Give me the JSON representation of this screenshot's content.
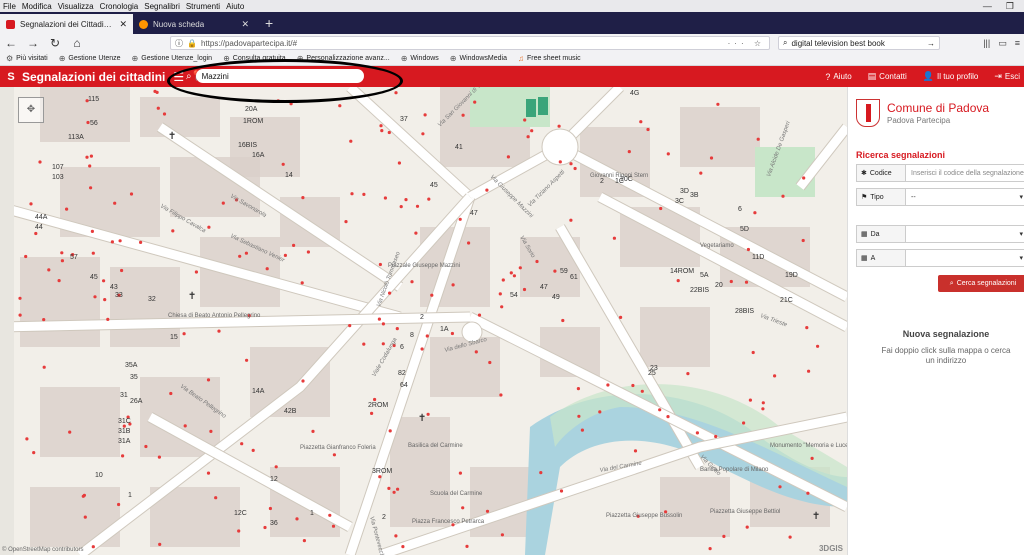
{
  "menubar": {
    "items": [
      "File",
      "Modifica",
      "Visualizza",
      "Cronologia",
      "Segnalibri",
      "Strumenti",
      "Aiuto"
    ]
  },
  "tabs": [
    {
      "label": "Segnalazioni dei Cittadini - Co",
      "active": true,
      "color": "#d71920"
    },
    {
      "label": "Nuova scheda",
      "active": false,
      "color": "#ff9500"
    }
  ],
  "address": {
    "url": "https://padovapartecipa.it/#",
    "search_value": "digital television best book"
  },
  "bookmarks": [
    "Più visitati",
    "Gestione Utenze",
    "Gestione Utenze_login",
    "Consulta gratuita",
    "Personalizzazione avanz...",
    "Windows",
    "WindowsMedia",
    "Free sheet music"
  ],
  "app": {
    "logo": "S",
    "title": "Segnalazioni dei cittadini",
    "search_value": "Mazzini",
    "nav": [
      "Aiuto",
      "Contatti",
      "Il tuo profilo",
      "Esci"
    ],
    "accent": "#d71920"
  },
  "map": {
    "place_labels": [
      "Piazzale Giuseppe Mazzini",
      "Piazzetta Gianfranco Foleria",
      "Piazza Francesco Petrarca",
      "Piazzetta Giuseppe Bussolin",
      "Piazzetta Giuseppe Bettiol",
      "Basilica del Carmine",
      "Chiesa di Beato Antonio Pellegrino",
      "Monumento \"Memoria e Luce\"",
      "Banca Popolare di Milano",
      "Scuola del Carmine",
      "Vegetariamo",
      "Giovanni Rigoni Stern"
    ],
    "street_labels": [
      "Viale Codalunga",
      "Via Savonarola",
      "Via Giotto",
      "Via Trieste",
      "Via Tiziano Aspetti",
      "Via Beato Pellegrino",
      "Via dello Sbarco",
      "Via del Carmine",
      "Via Giuseppe Mazzini",
      "Via Nicolò Tommaseo",
      "Via Filippo Cavalca",
      "Via Alcide De Gasperi",
      "Via San Giovanni di Verdara",
      "Via Sebastiano Venier",
      "Via Sorio",
      "Via Pontevecchio"
    ],
    "house_numbers": [
      "115",
      "113A",
      "107",
      "103",
      "56",
      "44A",
      "44",
      "57",
      "45",
      "43",
      "33",
      "32",
      "15",
      "35A",
      "35",
      "31",
      "26A",
      "31C",
      "31B",
      "31A",
      "10",
      "1",
      "14A",
      "42B",
      "2ROM",
      "3ROM",
      "82",
      "1A",
      "2",
      "8",
      "6",
      "64",
      "20A",
      "1ROM",
      "16BIS",
      "16A",
      "14",
      "37",
      "41",
      "45",
      "47",
      "59",
      "61",
      "47",
      "49",
      "54",
      "22BIS",
      "28BIS",
      "5A",
      "3B",
      "6",
      "19D",
      "21C",
      "4G",
      "10C",
      "2",
      "3C",
      "3D",
      "1C",
      "5D",
      "11D",
      "20",
      "12",
      "14ROM",
      "25",
      "23",
      "12C",
      "1",
      "36",
      "2"
    ],
    "attribution": "© OpenStreetMap contributors",
    "brand": "3DGIS",
    "colors": {
      "land": "#f2efe9",
      "building": "#d9d0c9",
      "road": "#ffffff",
      "water": "#aad3df",
      "park": "#c8e6c9",
      "marker": "#e63b3b"
    }
  },
  "panel": {
    "municipality": "Comune di Padova",
    "subtitle": "Padova Partecipa",
    "search_title": "Ricerca segnalazioni",
    "codice_label": "Codice",
    "codice_placeholder": "Inserisci il codice della segnalazione",
    "tipo_label": "Tipo",
    "tipo_value": "--",
    "da_label": "Da",
    "a_label": "A",
    "search_button": "Cerca segnalazioni",
    "new_title": "Nuova segnalazione",
    "new_hint": "Fai doppio click sulla mappa o cerca un indirizzo"
  }
}
